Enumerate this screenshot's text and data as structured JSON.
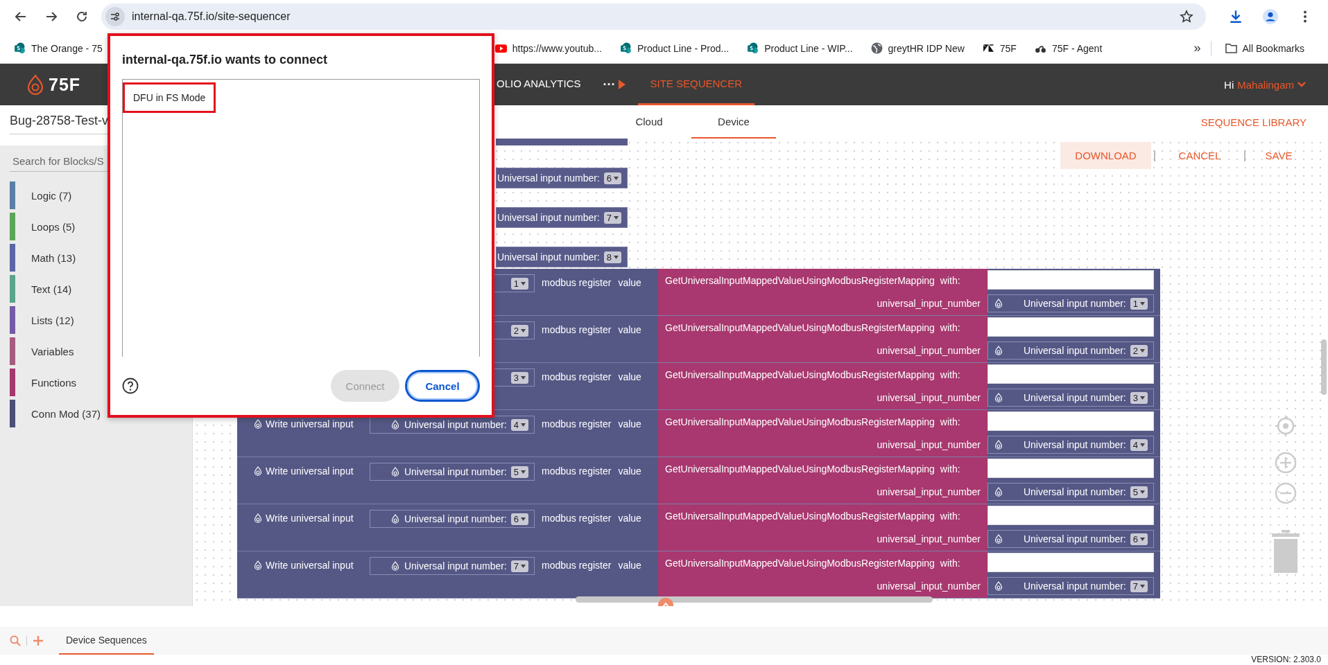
{
  "browser": {
    "url": "internal-qa.75f.io/site-sequencer",
    "bookmarks": [
      {
        "label": "The Orange - 75",
        "kind": "sharepoint"
      },
      {
        "label": "https://www.youtub...",
        "kind": "youtube"
      },
      {
        "label": "Product Line - Prod...",
        "kind": "sharepoint"
      },
      {
        "label": "Product Line - WIP...",
        "kind": "sharepoint"
      },
      {
        "label": "greytHR IDP New",
        "kind": "globe"
      },
      {
        "label": "75F",
        "kind": "zendesk"
      },
      {
        "label": "75F - Agent",
        "kind": "agent"
      }
    ],
    "overflow": "»",
    "all_bookmarks": "All Bookmarks"
  },
  "app_header": {
    "logo": "75F",
    "nav": [
      {
        "label": "OLIO ANALYTICS",
        "selected": false
      },
      {
        "label": "SITE SEQUENCER",
        "selected": true
      }
    ],
    "more": "···",
    "greeting": "Hi",
    "user": "Mahalingam"
  },
  "sidebar": {
    "title": "Bug-28758-Test-v",
    "search": {
      "placeholder": "Search for Blocks/S"
    },
    "categories": [
      {
        "label": "Logic (7)",
        "color": "#5b80a5"
      },
      {
        "label": "Loops (5)",
        "color": "#5ba55b"
      },
      {
        "label": "Math (13)",
        "color": "#5b67a5"
      },
      {
        "label": "Text (14)",
        "color": "#5ba58c"
      },
      {
        "label": "Lists (12)",
        "color": "#745ba5"
      },
      {
        "label": "Variables",
        "color": "#a55b80"
      },
      {
        "label": "Functions",
        "color": "#a5386e"
      },
      {
        "label": "Conn Mod (37)",
        "color": "#4a4e78"
      }
    ]
  },
  "tabs": [
    {
      "label": "Cloud",
      "selected": false
    },
    {
      "label": "Device",
      "selected": true
    }
  ],
  "sequence_library": "SEQUENCE LIBRARY",
  "actions": [
    {
      "label": "DOWNLOAD",
      "highlighted": true
    },
    {
      "label": "CANCEL",
      "highlighted": false
    },
    {
      "label": "SAVE",
      "highlighted": false
    }
  ],
  "canvas": {
    "loose_blocks": [
      {
        "label": "Universal input number:",
        "value": "6"
      },
      {
        "label": "Universal input number:",
        "value": "7"
      },
      {
        "label": "Universal input number:",
        "value": "8"
      }
    ],
    "rows": [
      {
        "input_value": "1",
        "register": "modbus register",
        "value_label": "value",
        "function": "GetUniversalInputMappedValueUsingModbusRegisterMapping",
        "with": "with:",
        "param": "universal_input_number",
        "param_input_label": "Universal input number:",
        "param_value": "1"
      },
      {
        "input_value": "2",
        "register": "modbus register",
        "value_label": "value",
        "function": "GetUniversalInputMappedValueUsingModbusRegisterMapping",
        "with": "with:",
        "param": "universal_input_number",
        "param_input_label": "Universal input number:",
        "param_value": "2"
      },
      {
        "input_value": "3",
        "register": "modbus register",
        "value_label": "value",
        "function": "GetUniversalInputMappedValueUsingModbusRegisterMapping",
        "with": "with:",
        "param": "universal_input_number",
        "param_input_label": "Universal input number:",
        "param_value": "3"
      },
      {
        "label": "Write universal input",
        "input_label": "Universal input number:",
        "input_value": "4",
        "register": "modbus register",
        "value_label": "value",
        "function": "GetUniversalInputMappedValueUsingModbusRegisterMapping",
        "with": "with:",
        "param": "universal_input_number",
        "param_input_label": "Universal input number:",
        "param_value": "4"
      },
      {
        "label": "Write universal input",
        "input_label": "Universal input number:",
        "input_value": "5",
        "register": "modbus register",
        "value_label": "value",
        "function": "GetUniversalInputMappedValueUsingModbusRegisterMapping",
        "with": "with:",
        "param": "universal_input_number",
        "param_input_label": "Universal input number:",
        "param_value": "5"
      },
      {
        "label": "Write universal input",
        "input_label": "Universal input number:",
        "input_value": "6",
        "register": "modbus register",
        "value_label": "value",
        "function": "GetUniversalInputMappedValueUsingModbusRegisterMapping",
        "with": "with:",
        "param": "universal_input_number",
        "param_input_label": "Universal input number:",
        "param_value": "6"
      },
      {
        "label": "Write universal input",
        "input_label": "Universal input number:",
        "input_value": "7",
        "register": "modbus register",
        "value_label": "value",
        "function": "GetUniversalInputMappedValueUsingModbusRegisterMapping",
        "with": "with:",
        "param": "universal_input_number",
        "param_input_label": "Universal input number:",
        "param_value": "7"
      }
    ]
  },
  "bottom_bar": {
    "tabs": [
      {
        "label": "Device Sequences",
        "selected": true
      }
    ]
  },
  "version": "VERSION: 2.303.0",
  "dialog": {
    "title": "internal-qa.75f.io wants to connect",
    "annotated": true,
    "devices": [
      {
        "name": "DFU in FS Mode",
        "annotated": true
      }
    ],
    "buttons": [
      {
        "label": "Connect",
        "disabled": true,
        "kind": "secondary"
      },
      {
        "label": "Cancel",
        "disabled": false,
        "kind": "primary"
      }
    ]
  }
}
